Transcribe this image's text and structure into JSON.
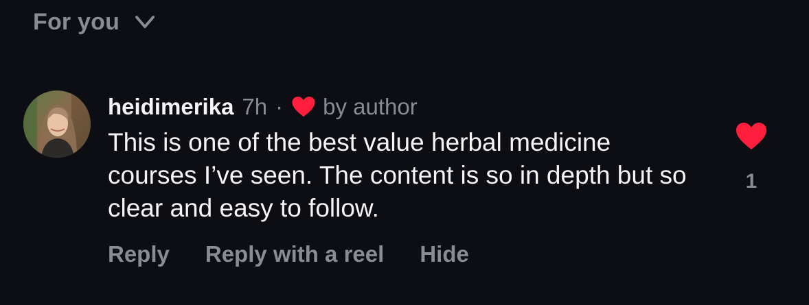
{
  "sort": {
    "label": "For you",
    "icon": "chevron-down-icon"
  },
  "comment": {
    "avatar_icon": "user-avatar",
    "username": "heidimerika",
    "time": "7h",
    "separator": "·",
    "author_like_icon": "heart-icon",
    "author_like_text": "by author",
    "text": "This is one of the best value herbal medicine courses I’ve seen. The content is so in depth but so clear and easy to follow.",
    "actions": {
      "reply": "Reply",
      "reply_with_reel": "Reply with a reel",
      "hide": "Hide"
    },
    "like_icon": "heart-icon",
    "like_count": "1"
  },
  "colors": {
    "background": "#0d0e14",
    "primary_text": "#f5f5f5",
    "secondary_text": "#8a8c92",
    "heart": "#ff1f3d"
  }
}
